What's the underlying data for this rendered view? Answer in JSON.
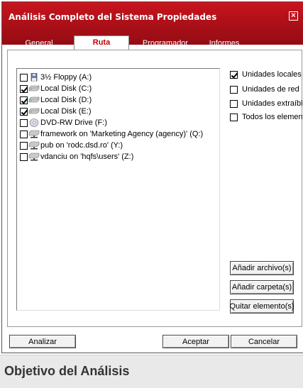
{
  "window": {
    "title": "Análisis Completo del Sistema Propiedades"
  },
  "tabs": [
    {
      "label": "General"
    },
    {
      "label": "Ruta"
    },
    {
      "label": "Programador"
    },
    {
      "label": "Informes"
    }
  ],
  "drives": [
    {
      "label": "3½ Floppy (A:)",
      "checked": false,
      "icon": "floppy-icon"
    },
    {
      "label": "Local Disk (C:)",
      "checked": true,
      "icon": "hard-disk-icon"
    },
    {
      "label": "Local Disk (D:)",
      "checked": true,
      "icon": "hard-disk-icon"
    },
    {
      "label": "Local Disk (E:)",
      "checked": true,
      "icon": "hard-disk-icon"
    },
    {
      "label": "DVD-RW Drive (F:)",
      "checked": false,
      "icon": "dvd-drive-icon"
    },
    {
      "label": "framework on 'Marketing Agency (agency)' (Q:)",
      "checked": false,
      "icon": "network-drive-icon"
    },
    {
      "label": "pub on 'rodc.dsd.ro' (Y:)",
      "checked": false,
      "icon": "network-drive-icon"
    },
    {
      "label": "vdanciu on 'hqfs\\users' (Z:)",
      "checked": false,
      "icon": "network-drive-icon"
    }
  ],
  "options": [
    {
      "label": "Unidades locales",
      "checked": true
    },
    {
      "label": "Unidades de red",
      "checked": false
    },
    {
      "label": "Unidades extraíbles",
      "checked": false
    },
    {
      "label": "Todos los elementos",
      "checked": false
    }
  ],
  "side_buttons": {
    "add_file": "Añadir archivo(s)",
    "add_folder": "Añadir carpeta(s)",
    "remove": "Quitar elemento(s)"
  },
  "bottom_buttons": {
    "analyze": "Analizar",
    "accept": "Aceptar",
    "cancel": "Cancelar"
  },
  "footer": {
    "title": "Objetivo del Análisis"
  },
  "colors": {
    "titlebar": "#b5121b",
    "active_tab_text": "#c00000"
  }
}
